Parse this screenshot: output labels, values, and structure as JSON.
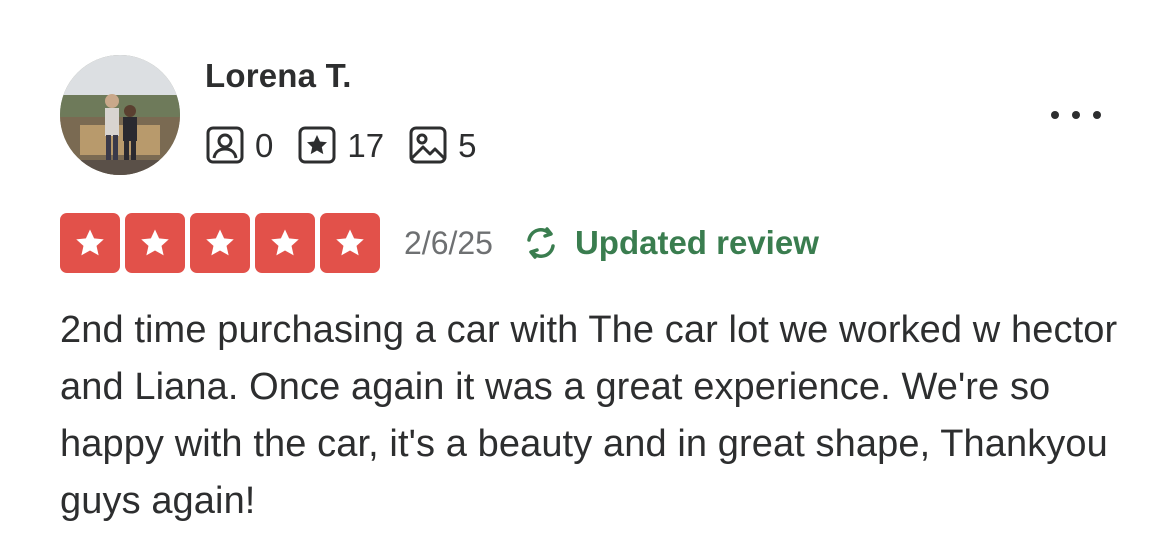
{
  "reviewer": {
    "name": "Lorena T.",
    "avatar": "reviewer-photo",
    "stats": [
      {
        "icon": "friends-icon",
        "value": "0"
      },
      {
        "icon": "reviews-star-icon",
        "value": "17"
      },
      {
        "icon": "photos-icon",
        "value": "5"
      }
    ]
  },
  "menu": {
    "icon": "more-options-icon"
  },
  "review": {
    "rating": 5,
    "rating_max": 5,
    "date": "2/6/25",
    "updated_label": "Updated review",
    "text": "2nd time purchasing a car with The car lot we worked w hector and Liana. Once again it was a great experience. We're so happy with the car, it's a beauty and in great shape, Thankyou guys again!"
  },
  "colors": {
    "star_fill": "#e2514a",
    "updated_green": "#3a7d4f",
    "text": "#2d2e2f",
    "muted": "#6e7072"
  }
}
